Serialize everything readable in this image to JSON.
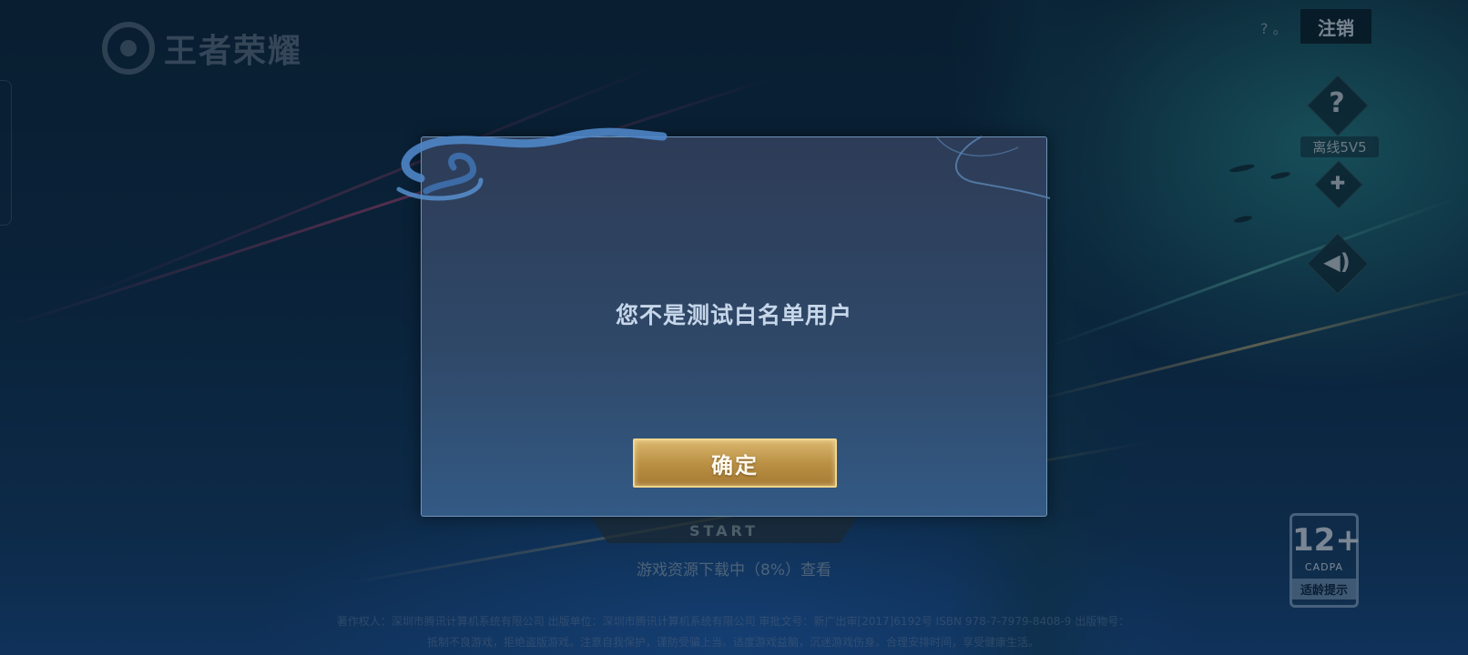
{
  "app": {
    "logo_text": "王者荣耀"
  },
  "top_right": {
    "help_small": "? 。",
    "logout_label": "注销",
    "help_icon": "question-icon",
    "offline_label": "离线5V5",
    "gamepad_icon": "gamepad-icon",
    "sound_icon": "sound-icon"
  },
  "start_button": {
    "label_en": "START"
  },
  "download": {
    "status_text": "游戏资源下载中（8%）查看"
  },
  "footer": {
    "line1": "著作权人：深圳市腾讯计算机系统有限公司  出版单位：深圳市腾讯计算机系统有限公司  审批文号：新广出审[2017]6192号  ISBN 978-7-7979-8408-9  出版物号：",
    "line2": "抵制不良游戏，拒绝盗版游戏。注意自我保护，谨防受骗上当。适度游戏益脑，沉迷游戏伤身。合理安排时间，享受健康生活。"
  },
  "age_rating": {
    "age": "12+",
    "org": "CADPA",
    "tip": "适龄提示"
  },
  "modal": {
    "message": "您不是测试白名单用户",
    "confirm_label": "确定"
  },
  "colors": {
    "modal_bg": "#2f4868",
    "modal_border": "#6f93b6",
    "button_gold": "#b88e42"
  }
}
